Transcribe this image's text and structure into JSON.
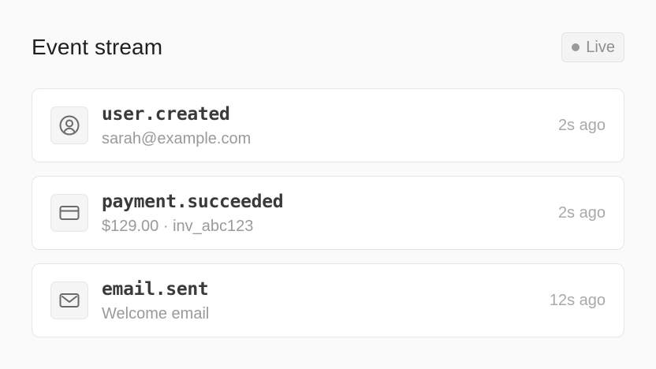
{
  "header": {
    "title": "Event stream",
    "live_label": "Live"
  },
  "events": [
    {
      "name": "user.created",
      "detail": "sarah@example.com",
      "time": "2s ago",
      "icon": "user-circle-icon"
    },
    {
      "name": "payment.succeeded",
      "detail": "$129.00 · inv_abc123",
      "time": "2s ago",
      "icon": "credit-card-icon"
    },
    {
      "name": "email.sent",
      "detail": "Welcome email",
      "time": "12s ago",
      "icon": "mail-icon"
    }
  ],
  "colors": {
    "background": "#fafafa",
    "card": "#ffffff",
    "border": "#e6e6e6",
    "muted_text": "#9a9a9a",
    "icon": "#6b6b6b"
  }
}
